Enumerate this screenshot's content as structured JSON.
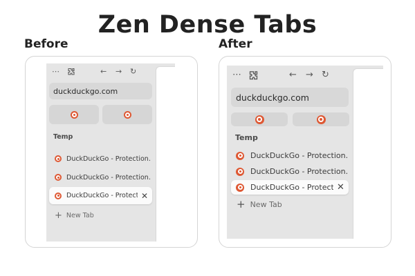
{
  "title": "Zen Dense Tabs",
  "before": {
    "caption": "Before",
    "url": "duckduckgo.com",
    "section_label": "Temp",
    "tabs": [
      "DuckDuckGo - Protection. Pr",
      "DuckDuckGo - Protection. Pr",
      "DuckDuckGo - Protection. Pr"
    ],
    "active_tab_index": 2,
    "new_tab_label": "New Tab"
  },
  "after": {
    "caption": "After",
    "url": "duckduckgo.com",
    "section_label": "Temp",
    "tabs": [
      "DuckDuckGo - Protection. Pr",
      "DuckDuckGo - Protection. Pr",
      "DuckDuckGo - Protection. Pr"
    ],
    "active_tab_index": 2,
    "new_tab_label": "New Tab"
  },
  "icons": {
    "menu": "more-horizontal-icon",
    "extensions": "puzzle-icon",
    "back": "arrow-left-icon",
    "forward": "arrow-right-icon",
    "reload": "reload-icon",
    "favicon": "duckduckgo-favicon-icon",
    "close": "close-icon",
    "new_tab": "plus-icon"
  },
  "colors": {
    "sidebar_bg": "#e5e5e5",
    "ddg_orange": "#de5833",
    "title_text": "#222222"
  }
}
